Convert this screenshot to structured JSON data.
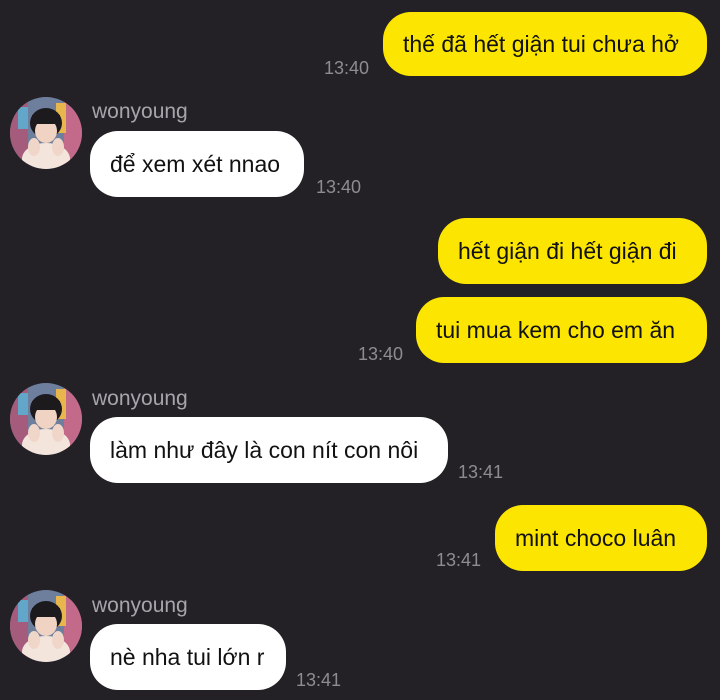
{
  "contact": {
    "name": "wonyoung"
  },
  "colors": {
    "background": "#242126",
    "outgoing_bubble": "#FCE501",
    "incoming_bubble": "#FFFFFF",
    "timestamp": "#8E8C92",
    "sender_name": "#A7A4AB"
  },
  "messages": [
    {
      "direction": "outgoing",
      "text": "thế đã hết giận tui chưa hở",
      "time": "13:40"
    },
    {
      "direction": "incoming",
      "sender": "wonyoung",
      "text": "để xem xét nnao",
      "time": "13:40"
    },
    {
      "direction": "outgoing",
      "text": "hết giận đi hết giận đi",
      "time": ""
    },
    {
      "direction": "outgoing",
      "text": "tui mua kem cho em ăn",
      "time": "13:40"
    },
    {
      "direction": "incoming",
      "sender": "wonyoung",
      "text": "làm như đây là con nít con nôi",
      "time": "13:41"
    },
    {
      "direction": "outgoing",
      "text": "mint choco luân",
      "time": "13:41"
    },
    {
      "direction": "incoming",
      "sender": "wonyoung",
      "text": "nè nha tui lớn r",
      "time": "13:41"
    }
  ]
}
